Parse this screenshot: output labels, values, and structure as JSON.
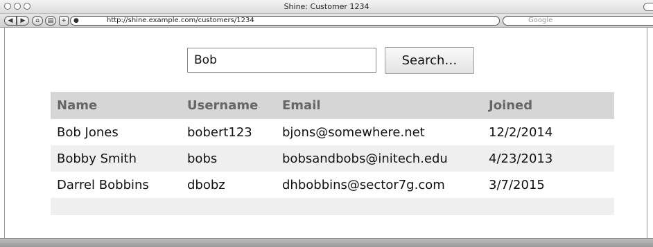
{
  "window": {
    "title": "Shine: Customer 1234"
  },
  "toolbar": {
    "back_icon": "left-arrow-icon",
    "forward_icon": "right-arrow-icon",
    "home_icon": "home-icon",
    "print_icon": "printer-icon",
    "add_icon": "plus-icon",
    "url": "http://shine.example.com/customers/1234",
    "search_placeholder": "Google"
  },
  "search": {
    "value": "Bob",
    "button_label": "Search…"
  },
  "table": {
    "headers": [
      "Name",
      "Username",
      "Email",
      "Joined"
    ],
    "rows": [
      [
        "Bob Jones",
        "bobert123",
        "bjons@somewhere.net",
        "12/2/2014"
      ],
      [
        "Bobby Smith",
        "bobs",
        "bobsandbobs@initech.edu",
        "4/23/2013"
      ],
      [
        "Darrel Bobbins",
        "dbobz",
        "dhbobbins@sector7g.com",
        "3/7/2015"
      ]
    ]
  }
}
